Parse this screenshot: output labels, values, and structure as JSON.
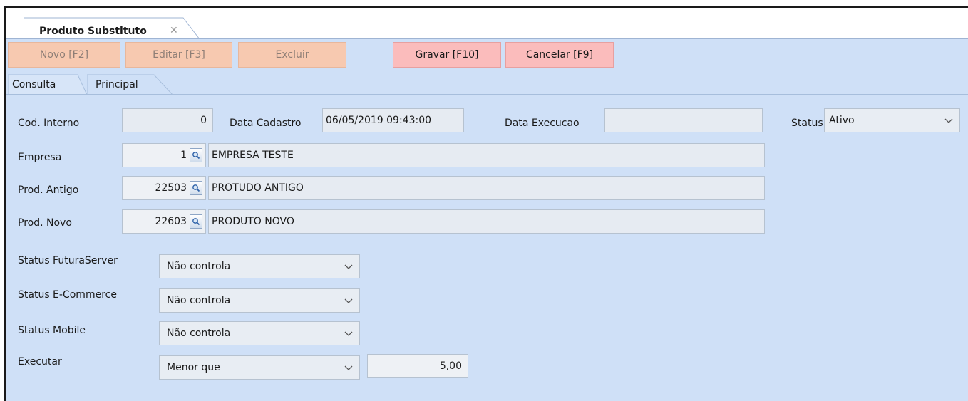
{
  "document_tab": {
    "title": "Produto Substituto",
    "close_glyph": "✕"
  },
  "toolbar": {
    "novo": "Novo [F2]",
    "editar": "Editar [F3]",
    "excluir": "Excluir",
    "gravar": "Gravar [F10]",
    "cancelar": "Cancelar [F9]"
  },
  "form_tabs": {
    "consulta": "Consulta",
    "principal": "Principal"
  },
  "form": {
    "cod_interno": {
      "label": "Cod. Interno",
      "value": "0"
    },
    "data_cadastro": {
      "label": "Data Cadastro",
      "value": "06/05/2019 09:43:00"
    },
    "data_execucao": {
      "label": "Data Execucao",
      "value": ""
    },
    "status": {
      "label": "Status",
      "value": "Ativo"
    },
    "empresa": {
      "label": "Empresa",
      "code": "1",
      "description": "EMPRESA TESTE"
    },
    "prod_antigo": {
      "label": "Prod. Antigo",
      "code": "22503",
      "description": "PROTUDO ANTIGO"
    },
    "prod_novo": {
      "label": "Prod. Novo",
      "code": "22603",
      "description": "PRODUTO NOVO"
    },
    "status_futuraserver": {
      "label": "Status FuturaServer",
      "value": "Não controla"
    },
    "status_ecommerce": {
      "label": "Status E-Commerce",
      "value": "Não controla"
    },
    "status_mobile": {
      "label": "Status Mobile",
      "value": "Não controla"
    },
    "executar": {
      "label": "Executar",
      "value": "Menor que",
      "amount": "5,00"
    }
  },
  "icons": {
    "lookup": "search-icon",
    "dropdown": "chevron-down-icon"
  },
  "colors": {
    "background": "#cfe0f7",
    "disabled_button": "#f7c9b0",
    "enabled_button": "#fbbcbc"
  }
}
